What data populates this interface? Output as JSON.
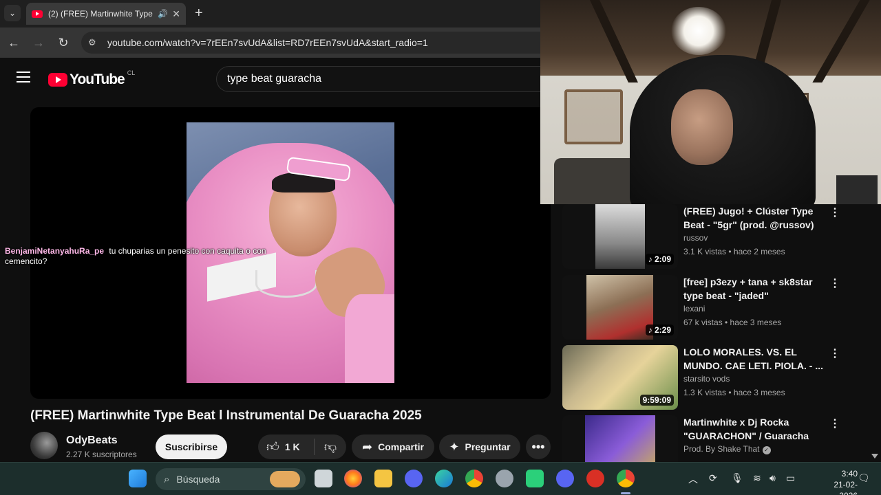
{
  "browser": {
    "tab_title": "(2) (FREE) Martinwhite Type",
    "url": "youtube.com/watch?v=7rEEn7svUdA&list=RD7rEEn7svUdA&start_radio=1"
  },
  "youtube": {
    "logo_text": "YouTube",
    "country_code": "CL",
    "search_query": "type beat guaracha"
  },
  "chat_overlay": {
    "username": "BenjamiNetanyahuRa_pe",
    "message": "tu chuparias un penesito con caquita o con cemencito?"
  },
  "video": {
    "title": "(FREE) Martinwhite Type Beat l Instrumental De Guaracha 2025",
    "channel": "OdyBeats",
    "subscribers": "2.27 K suscriptores",
    "subscribe_label": "Suscribirse",
    "like_count": "1 K",
    "share_label": "Compartir",
    "ask_label": "Preguntar"
  },
  "recommendations": [
    {
      "title": "(FREE) Jugo! +  Clúster Type Beat - \"5gr\" (prod. @russov)",
      "channel": "russov",
      "meta": "3.1 K vistas • hace 2 meses",
      "duration": "2:09",
      "music": true,
      "thumb_color": "#8a8a8a"
    },
    {
      "title": "[free] p3ezy + tana + sk8star type beat - \"jaded\"",
      "channel": "lexani",
      "meta": "67 k vistas • hace 3 meses",
      "duration": "2:29",
      "music": true,
      "thumb_color": "#6f5a47"
    },
    {
      "title": "LOLO MORALES. VS. EL MUNDO. CAE LETI. PIOLA. - ...",
      "channel": "starsito vods",
      "meta": "1.3 K vistas • hace 3 meses",
      "duration": "9:59:09",
      "music": false,
      "thumb_color": "#b8a98a"
    },
    {
      "title": "Martinwhite x Dj Rocka \"GUARACHON\" / Guaracha Typ...",
      "channel": "Prod. By Shake That",
      "meta": "",
      "duration": "",
      "music": false,
      "verified": true,
      "thumb_color": "#7a5cc8"
    }
  ],
  "taskbar": {
    "search_placeholder": "Búsqueda",
    "time": "3:40",
    "date": "21-02-2026",
    "taskbar_colors": {
      "background": "#1c2e2c"
    }
  },
  "colors": {
    "youtube_red": "#ff0033",
    "background": "#0f0f0f",
    "pill": "#272727"
  }
}
